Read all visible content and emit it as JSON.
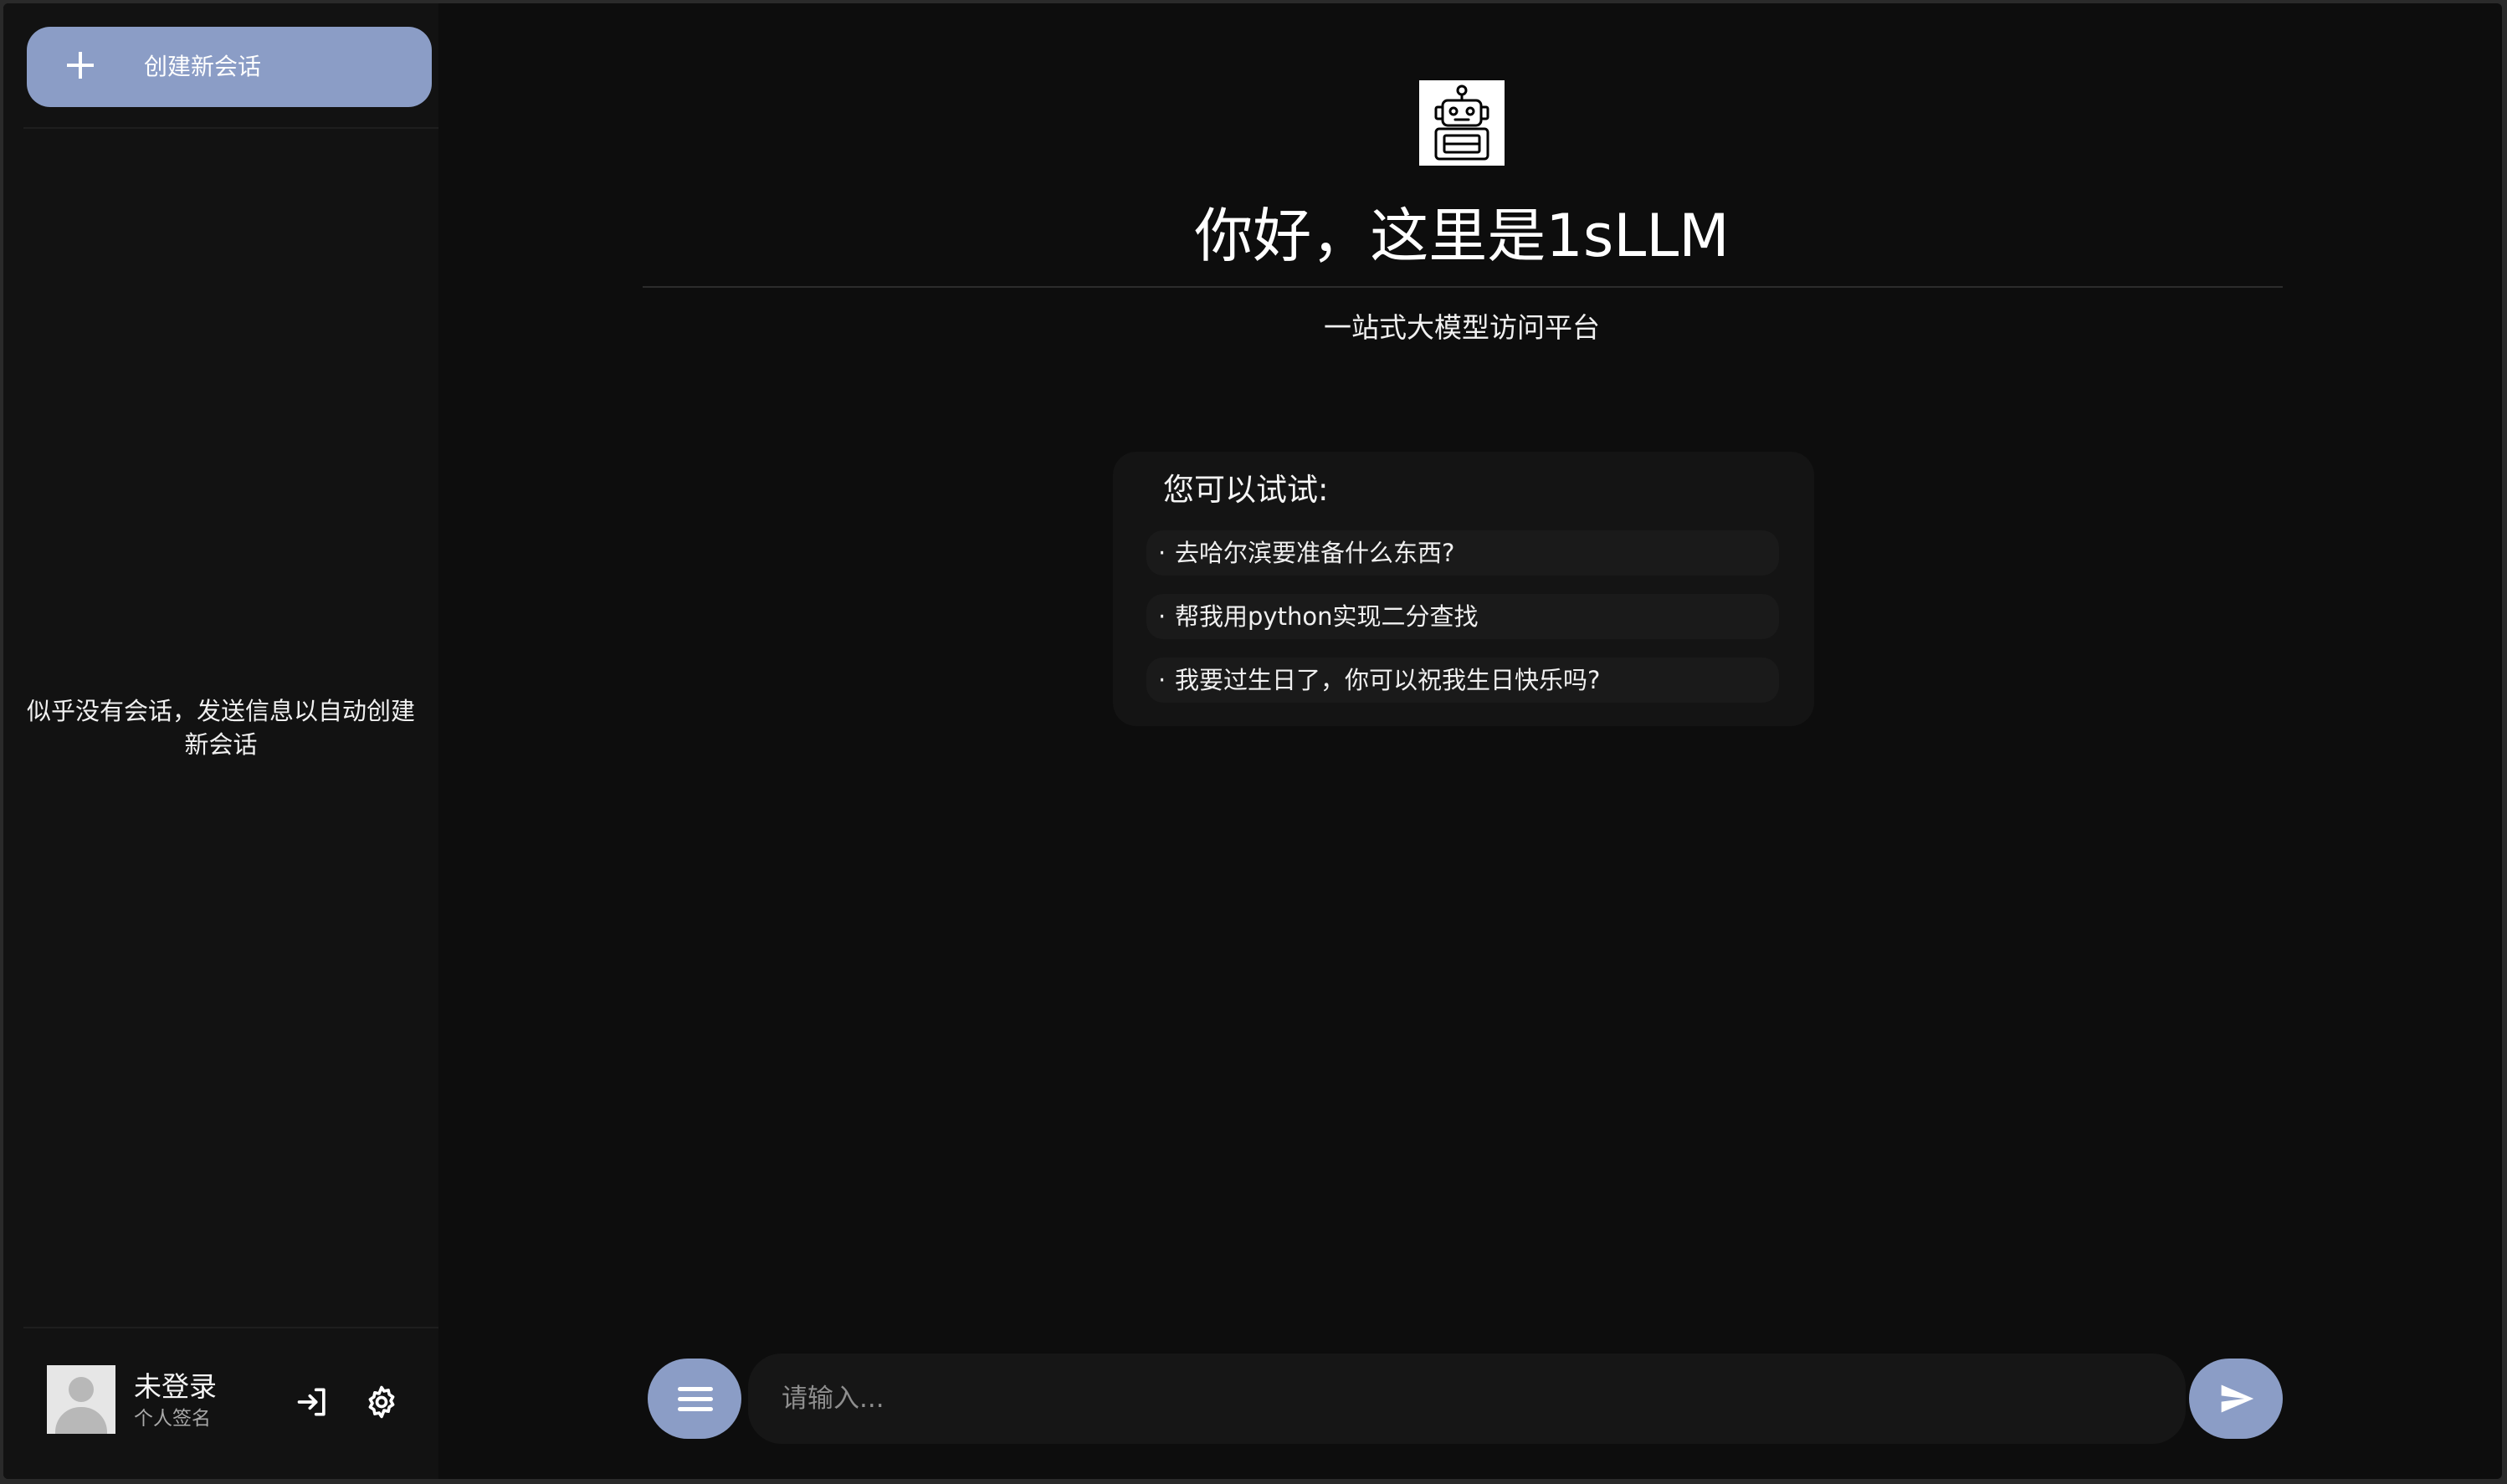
{
  "sidebar": {
    "new_chat_label": "创建新会话",
    "empty_message": "似乎没有会话，发送信息以自动创建新会话",
    "user": {
      "name": "未登录",
      "signature": "个人签名"
    },
    "icons": [
      "plus-icon",
      "avatar-placeholder",
      "login-icon",
      "gear-icon"
    ]
  },
  "main": {
    "logo_icon": "robot-icon",
    "title": "你好，这里是1sLLM",
    "subtitle": "一站式大模型访问平台",
    "suggestions": {
      "title": "您可以试试:",
      "bullet": "·",
      "items": [
        "去哈尔滨要准备什么东西?",
        "帮我用python实现二分查找",
        "我要过生日了，你可以祝我生日快乐吗?"
      ]
    },
    "input": {
      "placeholder": "请输入...",
      "value": ""
    },
    "icons": [
      "menu-icon",
      "send-icon"
    ]
  },
  "colors": {
    "background": "#0d0d0d",
    "sidebar": "#121212",
    "accent": "#8b9dc6",
    "text": "#ffffff",
    "muted_text": "#a8a8a8"
  }
}
